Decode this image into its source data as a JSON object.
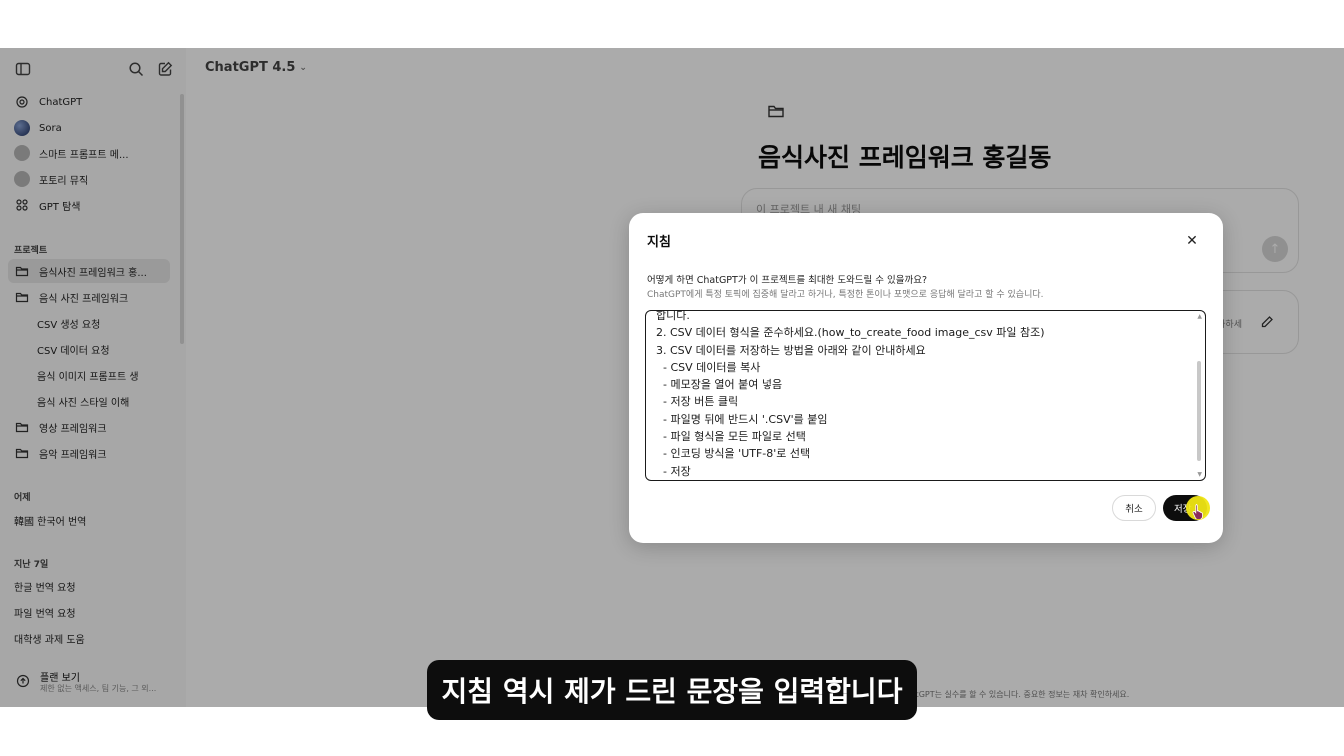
{
  "sidebar": {
    "top_items": [
      {
        "label": "ChatGPT",
        "icon": "openai-logo-icon"
      },
      {
        "label": "Sora",
        "icon": "sora-logo-icon"
      },
      {
        "label": "스마트 프롬프트 메...",
        "icon": "gpt-avatar-icon"
      },
      {
        "label": "포토리 뮤직",
        "icon": "gpt-avatar-icon"
      },
      {
        "label": "GPT 탐색",
        "icon": "grid-icon"
      }
    ],
    "projects_header": "프로젝트",
    "projects": [
      {
        "label": "음식사진 프레임워크 홍...",
        "icon": "folder-icon",
        "active": true
      },
      {
        "label": "음식 사진 프레임워크",
        "icon": "folder-icon"
      },
      {
        "label": "CSV 생성 요청",
        "sub": true
      },
      {
        "label": "CSV 데이터 요청",
        "sub": true
      },
      {
        "label": "음식 이미지 프롬프트 생",
        "sub": true
      },
      {
        "label": "음식 사진 스타일 이해",
        "sub": true
      },
      {
        "label": "영상 프레임워크",
        "icon": "folder-icon"
      },
      {
        "label": "음악 프레임워크",
        "icon": "folder-icon"
      }
    ],
    "yesterday_header": "어제",
    "yesterday": [
      {
        "label": "韓國 한국어 번역"
      }
    ],
    "last7_header": "지난 7일",
    "last7": [
      {
        "label": "한글 번역 요청"
      },
      {
        "label": "파일 번역 요청"
      },
      {
        "label": "대학생 과제 도움"
      }
    ],
    "plan_title": "플랜 보기",
    "plan_sub": "제한 없는 액세스, 팀 기능, 그 외..."
  },
  "header": {
    "model": "ChatGPT 4.5"
  },
  "main": {
    "project_title": "음식사진 프레임워크 홍길동",
    "chat_placeholder": "이 프로젝트 내 새 채팅",
    "instructions_label": "추가하세",
    "disclaimer": "ChatGPT는 실수를 할 수 있습니다. 중요한 정보는 재차 확인하세요."
  },
  "modal": {
    "title": "지침",
    "question": "어떻게 하면 ChatGPT가 이 프로젝트를 최대한 도와드릴 수 있을까요?",
    "hint": "ChatGPT에게 특정 토픽에 집중해 달라고 하거나, 특정한 톤이나 포맷으로 응답해 달라고 할 수 있습니다.",
    "lines": [
      "합니다.",
      "2. CSV 데이터 형식을 준수하세요.(how_to_create_food image_csv 파일 참조)",
      "3. CSV 데이터를 저장하는 방법을 아래와 같이 안내하세요",
      "  - CSV 데이터를 복사",
      "  - 메모장을 열어 붙여 넣음",
      "  - 저장 버튼 클릭",
      "  - 파일명 뒤에 반드시 '.CSV'를 붙임",
      "  - 파일 형식을 모든 파일로 선택",
      "  - 인코딩 방식을 'UTF-8'로 선택",
      "  - 저장"
    ],
    "cancel_label": "취소",
    "save_label": "저장"
  },
  "caption": "지침 역시 제가 드린 문장을 입력합니다"
}
